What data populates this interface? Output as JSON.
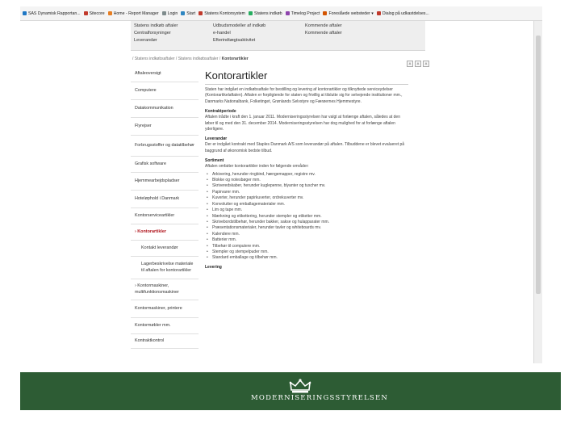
{
  "bookmarks": [
    {
      "label": "SAS Dynamisk Rapportan...",
      "color": "#1f77c4"
    },
    {
      "label": "Sitecore",
      "color": "#c0392b"
    },
    {
      "label": "Home - Report Manager",
      "color": "#e67e22"
    },
    {
      "label": "Login",
      "color": "#7f8c8d"
    },
    {
      "label": "Start",
      "color": "#2e86c1"
    },
    {
      "label": "Statens Kontorsystem",
      "color": "#c0392b"
    },
    {
      "label": "Statens indkøb",
      "color": "#27ae60"
    },
    {
      "label": "Timelog Project",
      "color": "#8e44ad"
    },
    {
      "label": "Foreslåede websteder ▾",
      "color": "#d35400"
    },
    {
      "label": "Dialog på udkastdelses...",
      "color": "#c0392b"
    }
  ],
  "megamenu": {
    "col1": [
      "Statens indkøb aftaler",
      "Centralforsyninger",
      "Leverandør"
    ],
    "col2": [
      "Udbudsmodeller af indkøb",
      "e-handel",
      "Efterindtægtsaktivitet"
    ],
    "col3": [
      "Kommende aftaler",
      "Kommende aftaler"
    ]
  },
  "breadcrumb": {
    "trail": "/ Statens indkøbsaftaler / Statens indkøbsaftaler / ",
    "current": "Kontorartikler"
  },
  "tools": [
    "A",
    "A",
    "A"
  ],
  "leftnav": [
    {
      "label": "Aftaleoversigt",
      "sub": false,
      "active": false,
      "h": 20
    },
    {
      "label": "Computere",
      "sub": false,
      "active": false,
      "h": 22
    },
    {
      "label": "Datakommunikation",
      "sub": false,
      "active": false,
      "h": 22
    },
    {
      "label": "Flyrejser",
      "sub": false,
      "active": false,
      "h": 22
    },
    {
      "label": "Forbrugsstoffer og datatilbehør",
      "sub": false,
      "active": false,
      "h": 26
    },
    {
      "label": "Grafisk software",
      "sub": false,
      "active": false,
      "h": 20
    },
    {
      "label": "Hjemmearbejdspladser",
      "sub": false,
      "active": false,
      "h": 22
    },
    {
      "label": "Hoteløphold i Danmark",
      "sub": false,
      "active": false,
      "h": 22
    },
    {
      "label": "Kontorserviceartikler",
      "sub": false,
      "active": false,
      "h": 20
    },
    {
      "label": "› Kontorartikler",
      "sub": false,
      "active": true,
      "h": 20
    },
    {
      "label": "Kontakt leverandør",
      "sub": true,
      "active": false,
      "h": 20
    },
    {
      "label": "Lagerbeskrivelse materiale til aftalen for kontorartikler",
      "sub": true,
      "active": false,
      "h": 28
    },
    {
      "label": "› Kontormaskiner, multifunktionsmaskiner",
      "sub": false,
      "active": false,
      "h": 26
    },
    {
      "label": "Kontormaskiner, printere",
      "sub": false,
      "active": false,
      "h": 22
    },
    {
      "label": "Kontormøbler mm.",
      "sub": false,
      "active": false,
      "h": 20
    },
    {
      "label": "Kontraktkontrol",
      "sub": false,
      "active": false,
      "h": 18
    }
  ],
  "content": {
    "title": "Kontorartikler",
    "intro": "Staten har indgået en indkøbsaftale for bestilling og levering af kontorartikler og tilknyttede serviceydelser (Kontorartikelaftalen). Aftalen er forpligtende for staten og frivillig at tilslutte sig for selvejende institutioner mm., Danmarks Nationalbank, Folketinget, Grønlands Selvstyre og Færøernes Hjemmestyre.",
    "period_head": "Kontraktperiode",
    "period": "Aftalen trådte i kraft den 1. januar 2011. Moderniseringsstyrelsen har valgt at forlænge aftalen, således at den løber til og med den 31. december 2014. Moderniseringsstyrelsen har dog mulighed for at forlænge aftalen yderligere.",
    "supplier_head": "Leverandør",
    "supplier": "Der er indgået kontrakt med Staples Danmark A/S som leverandør på aftalen. Tilbuddene er blevet evalueret på baggrund af økonomisk bedste tilbud.",
    "assortment_head": "Sortiment",
    "assortment_intro": "Aftalen omfatter kontorartikler inden for følgende områder:",
    "items": [
      "Arkivering, herunder ringbind, hængemapper, registre mv.",
      "Blokke og notesbøger mm.",
      "Skriveredskaber, herunder kuglepenne, blyanter og tuscher mv.",
      "Papirvarer mm.",
      "Kuverter, herunder papirkuverter, ordrekuverter mv.",
      "Konvolutter og emballagematerialer mm.",
      "Lim og tape mm.",
      "Mærkning og etikettering, herunder stempler og etiketter mm.",
      "Skrivebordstilbehør, herunder bakker, sakse og hulapparater mm.",
      "Præsentationsmaterialer, herunder tavler og whiteboards mv.",
      "Kalendere mm.",
      "Batterier mm.",
      "Tilbehør til computere mm.",
      "Stempler og stempelpuder mm.",
      "Standard emballage og tilbehør mm."
    ],
    "delivery_head": "Levering"
  },
  "footer": {
    "org_name": "MODERNISERINGSSTYRELSEN",
    "bar_color": "#2d5c34",
    "crown_icon": "crown-icon"
  }
}
